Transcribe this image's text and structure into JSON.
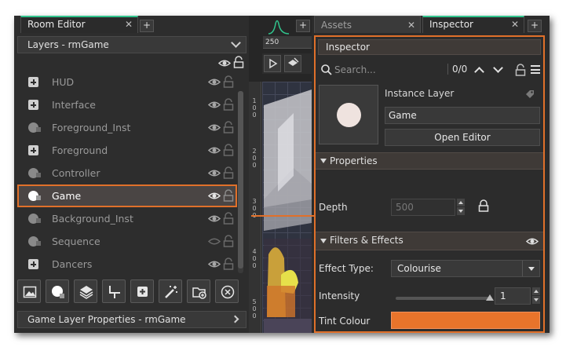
{
  "left_panel": {
    "tab_label": "Room Editor",
    "close_symbol": "✕",
    "add_tab_symbol": "+",
    "layers_dropdown": "Layers - rmGame",
    "layers": [
      {
        "name": "HUD",
        "icon": "layer-folder-plus-icon",
        "eye": "visible"
      },
      {
        "name": "Interface",
        "icon": "layer-folder-plus-icon",
        "eye": "visible"
      },
      {
        "name": "Foreground_Inst",
        "icon": "instance-layer-icon",
        "eye": "visible"
      },
      {
        "name": "Foreground",
        "icon": "layer-folder-plus-icon",
        "eye": "visible"
      },
      {
        "name": "Controller",
        "icon": "instance-layer-icon",
        "eye": "visible"
      },
      {
        "name": "Game",
        "icon": "instance-layer-icon",
        "eye": "visible",
        "selected": true
      },
      {
        "name": "Background_Inst",
        "icon": "instance-layer-icon",
        "eye": "visible"
      },
      {
        "name": "Sequence",
        "icon": "instance-layer-icon",
        "eye": "hidden"
      },
      {
        "name": "Dancers",
        "icon": "layer-folder-plus-icon",
        "eye": "visible"
      }
    ],
    "footer": "Game Layer Properties - rmGame"
  },
  "room_view": {
    "ruler_top_value": "250",
    "ruler_left_values": [
      "1\n0\n0",
      "2\n0\n0",
      "3\n0\n0",
      "4\n0\n0",
      "5\n0\n0"
    ],
    "add_tab_symbol": "+"
  },
  "right_panel": {
    "tabs": [
      {
        "label": "Assets",
        "active": false
      },
      {
        "label": "Inspector",
        "active": true
      }
    ],
    "close_symbol": "✕",
    "add_tab_symbol": "+",
    "inspector_title": "Inspector",
    "search_placeholder": "Search...",
    "search_count": "0/0",
    "layer_type": "Instance Layer",
    "layer_name": "Game",
    "open_editor": "Open Editor",
    "properties_header": "Properties",
    "depth_label": "Depth",
    "depth_value": "500",
    "filters_header": "Filters & Effects",
    "effect_type_label": "Effect Type:",
    "effect_type_value": "Colourise",
    "intensity_label": "Intensity",
    "intensity_value": "1",
    "tint_label": "Tint Colour",
    "tint_color": "#e8742b",
    "accent_color": "#e0702a"
  }
}
